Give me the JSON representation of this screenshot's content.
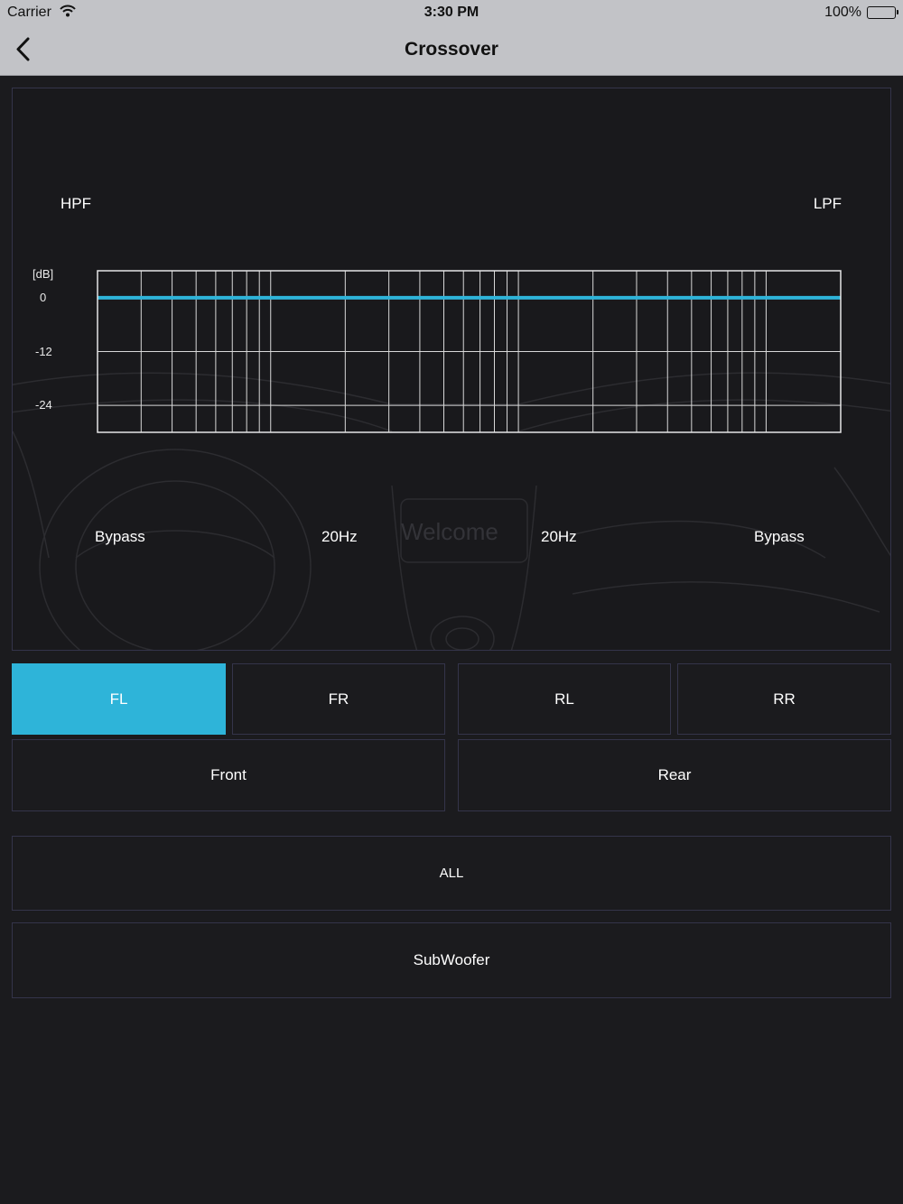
{
  "status_bar": {
    "carrier": "Carrier",
    "time": "3:30 PM",
    "battery": "100%"
  },
  "nav": {
    "title": "Crossover",
    "back_icon": "chevron-left-icon"
  },
  "panel": {
    "hpf_label": "HPF",
    "lpf_label": "LPF",
    "hpf_frequency": "20Hz",
    "hpf_slope": "Bypass",
    "lpf_frequency": "20Hz",
    "lpf_slope": "Bypass",
    "watermark_text": "Welcome"
  },
  "chart_data": {
    "type": "line",
    "ylabel": "[dB]",
    "y_ticks": [
      "0",
      "-12",
      "-24"
    ],
    "y_tick_values": [
      0,
      -12,
      -24
    ],
    "ylim": [
      -30,
      6
    ],
    "xscale": "log",
    "xlim": [
      20,
      20000
    ],
    "x_grid": [
      20,
      30,
      40,
      50,
      60,
      70,
      80,
      90,
      100,
      200,
      300,
      400,
      500,
      600,
      700,
      800,
      900,
      1000,
      2000,
      3000,
      4000,
      5000,
      6000,
      7000,
      8000,
      9000,
      10000,
      20000
    ],
    "grid": true,
    "color": "#2eb4d9",
    "series": [
      {
        "x": [
          20,
          20000
        ],
        "y": [
          0,
          0
        ]
      }
    ]
  },
  "channels": {
    "fl": "FL",
    "fr": "FR",
    "rl": "RL",
    "rr": "RR",
    "front": "Front",
    "rear": "Rear",
    "all": "ALL",
    "subwoofer": "SubWoofer",
    "selected": "FL"
  }
}
